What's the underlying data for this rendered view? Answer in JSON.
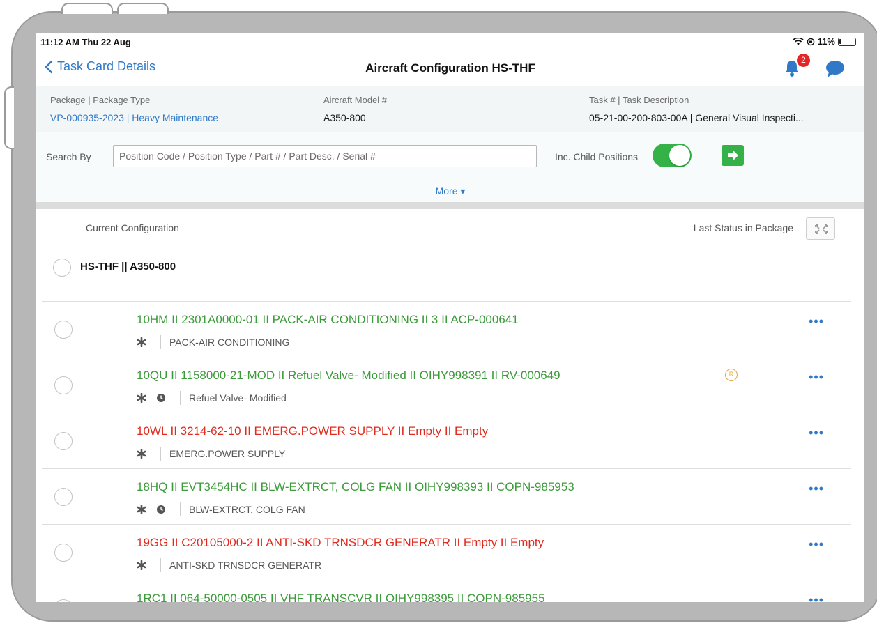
{
  "status_bar": {
    "time": "11:12 AM  Thu 22 Aug",
    "battery": "11%"
  },
  "nav": {
    "back_label": "Task Card Details",
    "title": "Aircraft Configuration HS-THF",
    "notification_count": "2"
  },
  "info": {
    "package_label": "Package | Package Type",
    "package_value": "VP-000935-2023 | Heavy Maintenance",
    "model_label": "Aircraft Model #",
    "model_value": "A350-800",
    "task_label": "Task # | Task Description",
    "task_value": "05-21-00-200-803-00A | General Visual Inspecti..."
  },
  "search": {
    "label": "Search By",
    "placeholder": "Position Code / Position Type / Part # / Part Desc. / Serial #",
    "value": "",
    "child_label": "Inc. Child Positions",
    "child_enabled": true,
    "more_label": "More ▾"
  },
  "list": {
    "current_label": "Current Configuration",
    "last_status_label": "Last Status in Package",
    "root": "HS-THF || A350-800",
    "rows": [
      {
        "title": "10HM II 2301A0000-01 II PACK-AIR CONDITIONING II 3 II ACP-000641",
        "desc": "PACK-AIR CONDITIONING",
        "status": "green",
        "clock": false,
        "badge": ""
      },
      {
        "title": "10QU II 1158000-21-MOD II Refuel Valve- Modified II OIHY998391 II RV-000649",
        "desc": "Refuel Valve- Modified",
        "status": "green",
        "clock": true,
        "badge": "R"
      },
      {
        "title": "10WL II 3214-62-10 II EMERG.POWER SUPPLY II Empty II Empty",
        "desc": "EMERG.POWER SUPPLY",
        "status": "red",
        "clock": false,
        "badge": ""
      },
      {
        "title": "18HQ II EVT3454HC II BLW-EXTRCT, COLG FAN II OIHY998393 II COPN-985953",
        "desc": "BLW-EXTRCT, COLG FAN",
        "status": "green",
        "clock": true,
        "badge": ""
      },
      {
        "title": "19GG II C20105000-2 II ANTI-SKD TRNSDCR GENERATR II Empty II Empty",
        "desc": "ANTI-SKD TRNSDCR GENERATR",
        "status": "red",
        "clock": false,
        "badge": ""
      },
      {
        "title": "1RC1 II 064-50000-0505 II VHF            TRANSCVR II OIHY998395 II COPN-985955",
        "desc": "",
        "status": "green",
        "clock": false,
        "badge": ""
      }
    ]
  },
  "colors": {
    "accent": "#2f79c6",
    "ok": "#3c9b3a",
    "error": "#e02a1e",
    "toggle": "#34b248"
  }
}
